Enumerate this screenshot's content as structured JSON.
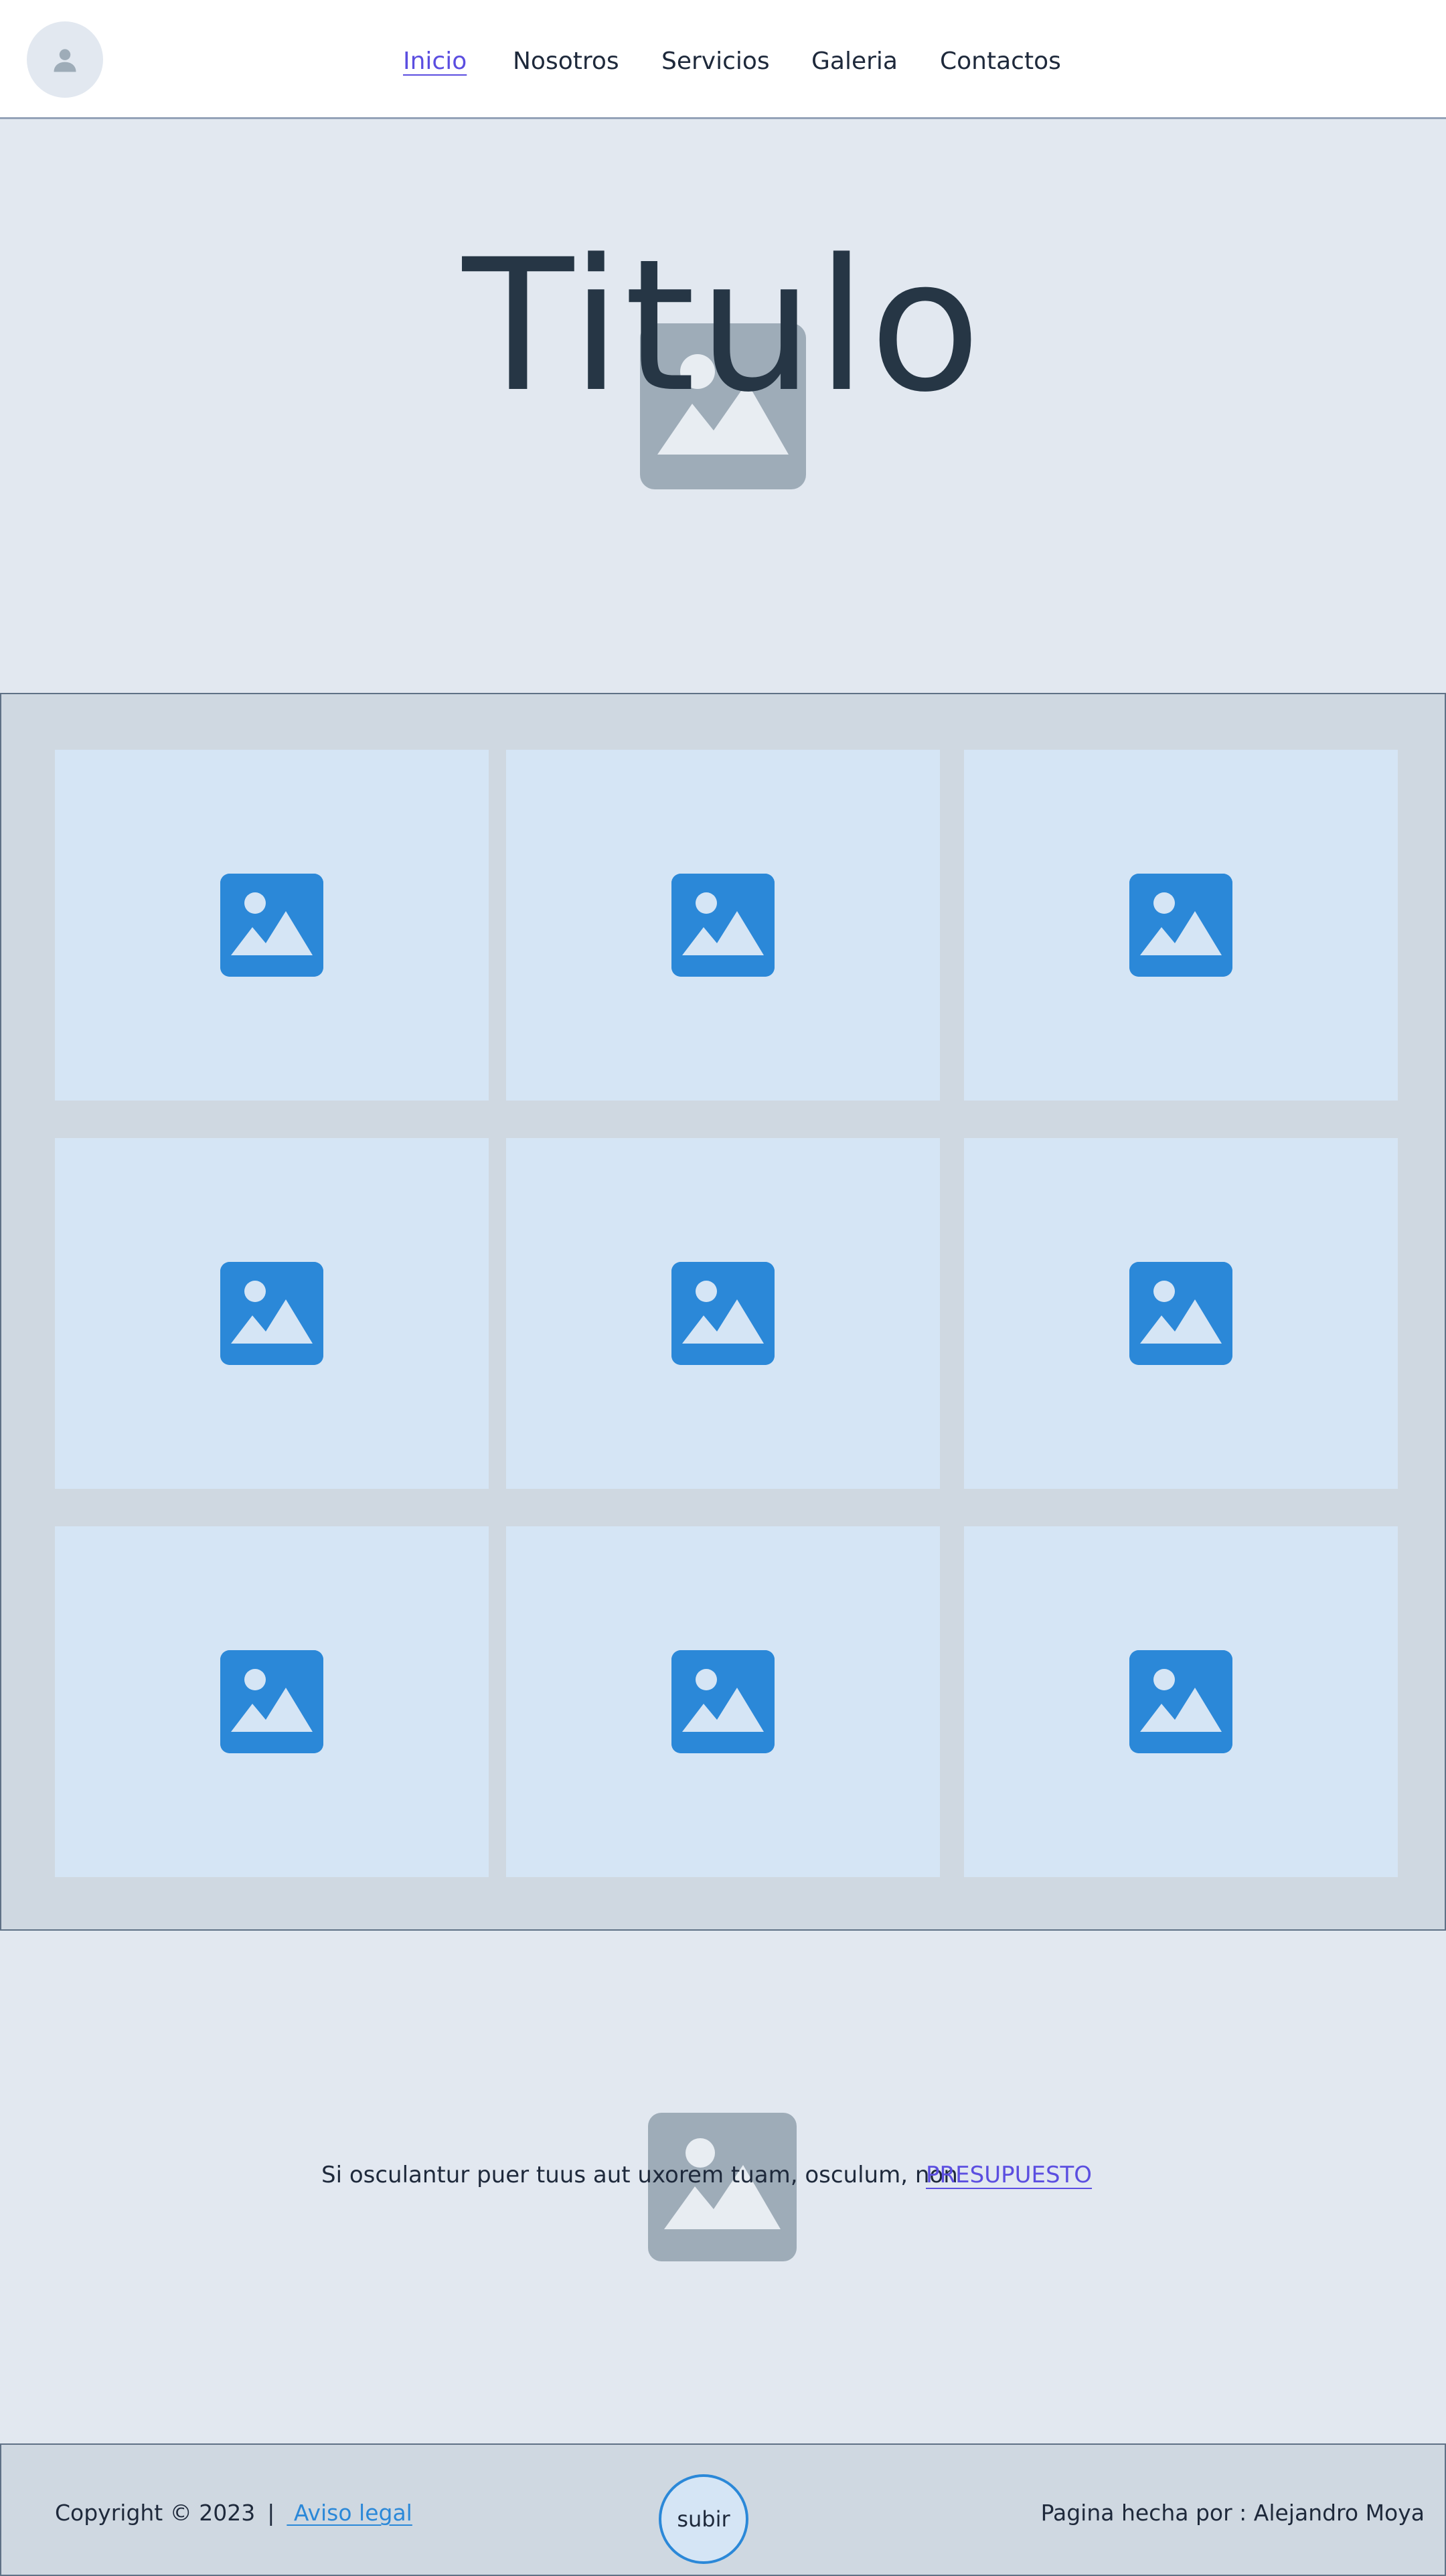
{
  "header": {
    "avatar_icon": "user-icon",
    "nav": [
      {
        "label": "Inicio",
        "active": true
      },
      {
        "label": "Nosotros",
        "active": false
      },
      {
        "label": "Servicios",
        "active": false
      },
      {
        "label": "Galeria",
        "active": false
      },
      {
        "label": "Contactos",
        "active": false
      }
    ]
  },
  "hero": {
    "title": "Titulo",
    "image_icon": "image-placeholder-icon"
  },
  "gallery": {
    "tiles": [
      {
        "icon": "image-icon"
      },
      {
        "icon": "image-icon"
      },
      {
        "icon": "image-icon"
      },
      {
        "icon": "image-icon"
      },
      {
        "icon": "image-icon"
      },
      {
        "icon": "image-icon"
      },
      {
        "icon": "image-icon"
      },
      {
        "icon": "image-icon"
      },
      {
        "icon": "image-icon"
      }
    ]
  },
  "cta": {
    "text": "Si osculantur puer tuus aut uxorem tuam, osculum, non",
    "link_label": "PRESUPUESTO",
    "image_icon": "image-placeholder-icon"
  },
  "footer": {
    "copyright": "Copyright © 2023",
    "separator": "|",
    "legal_link": " Aviso legal",
    "up_button": "subir",
    "credit": "Pagina hecha por : Alejandro Moya"
  },
  "colors": {
    "accent": "#5b4ee0",
    "link_blue": "#2b88d8",
    "tile_bg": "#d5e5f5",
    "section_bg": "#cfd8e1",
    "page_bg": "#e2e8f0"
  }
}
